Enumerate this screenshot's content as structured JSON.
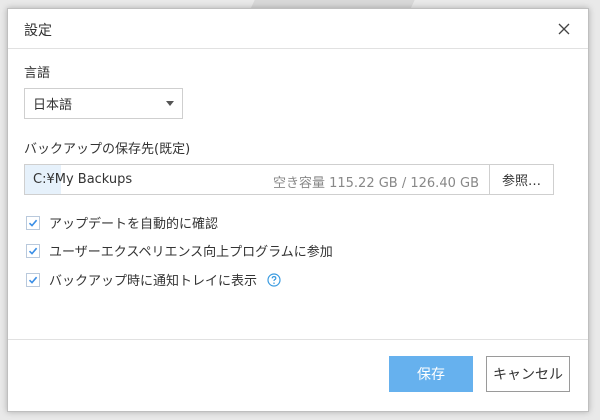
{
  "dialog": {
    "title": "設定"
  },
  "language": {
    "label": "言語",
    "selected": "日本語"
  },
  "backup": {
    "label": "バックアップの保存先(既定)",
    "path": "C:¥My Backups",
    "capacity": "空き容量 115.22 GB / 126.40 GB",
    "browse_label": "参照…"
  },
  "options": [
    {
      "label": "アップデートを自動的に確認",
      "checked": true
    },
    {
      "label": "ユーザーエクスペリエンス向上プログラムに参加",
      "checked": true
    },
    {
      "label": "バックアップ時に通知トレイに表示",
      "checked": true
    }
  ],
  "footer": {
    "save_label": "保存",
    "cancel_label": "キャンセル"
  },
  "colors": {
    "accent": "#66b1ee",
    "check": "#3a8ee6",
    "help": "#3a9be0"
  },
  "icons": {
    "close": "close-icon",
    "caret": "chevron-down-icon",
    "check": "check-icon",
    "help": "help-icon"
  }
}
